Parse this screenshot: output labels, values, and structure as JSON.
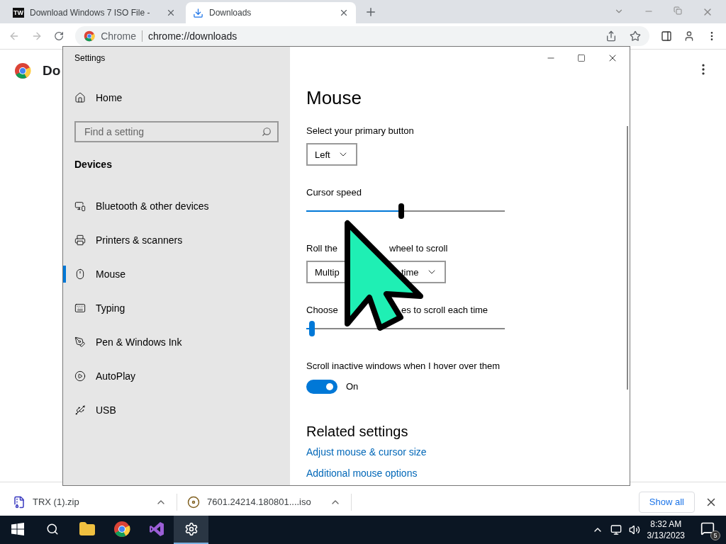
{
  "browser": {
    "tabs": [
      {
        "title": "Download Windows 7 ISO File -",
        "badge": "TW",
        "selected": false
      },
      {
        "title": "Downloads",
        "selected": true
      }
    ],
    "address": {
      "site": "Chrome",
      "url": "chrome://downloads"
    },
    "page_heading": "Do",
    "downloads": [
      "TRX (1).zip",
      "7601.24214.180801....iso"
    ],
    "show_all": "Show all"
  },
  "settings": {
    "title": "Settings",
    "home": "Home",
    "search": {
      "placeholder": "Find a setting"
    },
    "section": "Devices",
    "nav": [
      {
        "label": "Bluetooth & other devices",
        "selected": false
      },
      {
        "label": "Printers & scanners",
        "selected": false
      },
      {
        "label": "Mouse",
        "selected": true
      },
      {
        "label": "Typing",
        "selected": false
      },
      {
        "label": "Pen & Windows Ink",
        "selected": false
      },
      {
        "label": "AutoPlay",
        "selected": false
      },
      {
        "label": "USB",
        "selected": false
      }
    ],
    "heading": "Mouse",
    "controls": [
      {
        "kind": "dropdown",
        "label_parts": [
          "Select your primary button"
        ],
        "value_parts": [
          "Left"
        ]
      },
      {
        "kind": "slider",
        "label_parts": [
          "Cursor speed"
        ],
        "level": 0.48,
        "focused": true
      },
      {
        "kind": "dropdown",
        "label_parts": [
          "Roll the",
          "wheel to scroll"
        ],
        "value_parts": [
          "Multip",
          "time"
        ]
      },
      {
        "kind": "slider",
        "label_parts": [
          "Choose",
          "es to scroll each time"
        ],
        "level": 0.03,
        "focused": false
      },
      {
        "kind": "toggle",
        "label_parts": [
          "Scroll inactive windows when I hover over them"
        ],
        "on": true,
        "state_text": "On"
      }
    ],
    "related": {
      "heading": "Related settings",
      "links": [
        "Adjust mouse & cursor size",
        "Additional mouse options"
      ]
    }
  },
  "taskbar": {
    "apps": [
      {
        "kind": "explorer",
        "active": false
      },
      {
        "kind": "chrome",
        "active": false
      },
      {
        "kind": "studio",
        "active": false
      },
      {
        "kind": "settings",
        "active": true
      }
    ],
    "time": "8:32 AM",
    "date": "3/13/2023",
    "notifications": "5"
  }
}
